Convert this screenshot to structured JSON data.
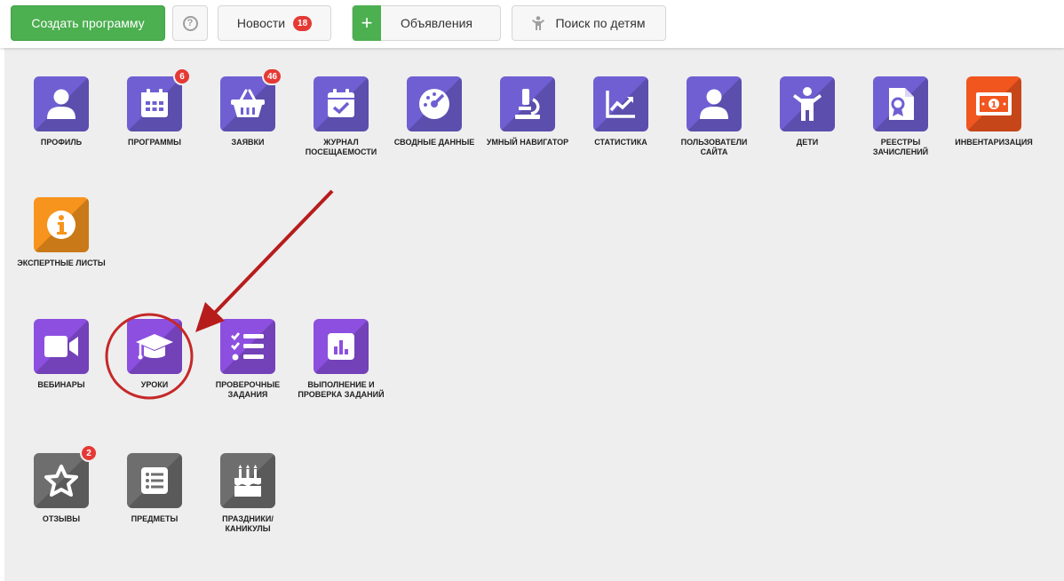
{
  "toolbar": {
    "create_program": "Создать программу",
    "help": "?",
    "news_label": "Новости",
    "news_count": "18",
    "ads_label": "Объявления",
    "children_search": "Поиск по детям"
  },
  "tiles_row1": [
    {
      "label": "ПРОФИЛЬ",
      "icon": "user-icon"
    },
    {
      "label": "ПРОГРАММЫ",
      "icon": "calendar-icon",
      "badge": "6"
    },
    {
      "label": "ЗАЯВКИ",
      "icon": "basket-icon",
      "badge": "46"
    },
    {
      "label": "ЖУРНАЛ ПОСЕЩАЕМОСТИ",
      "icon": "calendar-check-icon"
    },
    {
      "label": "СВОДНЫЕ ДАННЫЕ",
      "icon": "gauge-icon"
    },
    {
      "label": "УМНЫЙ НАВИГАТОР",
      "icon": "microscope-icon"
    },
    {
      "label": "СТАТИСТИКА",
      "icon": "chart-line-icon"
    },
    {
      "label": "ПОЛЬЗОВАТЕЛИ САЙТА",
      "icon": "user-icon"
    },
    {
      "label": "ДЕТИ",
      "icon": "child-icon"
    },
    {
      "label": "РЕЕСТРЫ ЗАЧИСЛЕНИЙ",
      "icon": "certificate-icon"
    },
    {
      "label": "ИНВЕНТАРИЗАЦИЯ",
      "icon": "banknote-icon"
    }
  ],
  "tiles_row2": [
    {
      "label": "ЭКСПЕРТНЫЕ ЛИСТЫ",
      "icon": "info-icon"
    }
  ],
  "tiles_row3": [
    {
      "label": "ВЕБИНАРЫ",
      "icon": "video-icon"
    },
    {
      "label": "УРОКИ",
      "icon": "graduation-cap-icon"
    },
    {
      "label": "ПРОВЕРОЧНЫЕ ЗАДАНИЯ",
      "icon": "checklist-icon"
    },
    {
      "label": "ВЫПОЛНЕНИЕ И ПРОВЕРКА ЗАДАНИЙ",
      "icon": "bar-chart-icon"
    }
  ],
  "tiles_row4": [
    {
      "label": "ОТЗЫВЫ",
      "icon": "star-icon",
      "badge": "2"
    },
    {
      "label": "ПРЕДМЕТЫ",
      "icon": "list-icon"
    },
    {
      "label": "ПРАЗДНИКИ/ КАНИКУЛЫ",
      "icon": "cake-icon"
    }
  ],
  "colors": {
    "green": "#4caf50",
    "indigo": "#6f5fd3",
    "violet": "#8c4fe0",
    "orange": "#f7941d",
    "orange_red": "#f1561f",
    "gray": "#6e6e6e",
    "badge_red": "#e53935",
    "annotation_red": "#c62828"
  }
}
